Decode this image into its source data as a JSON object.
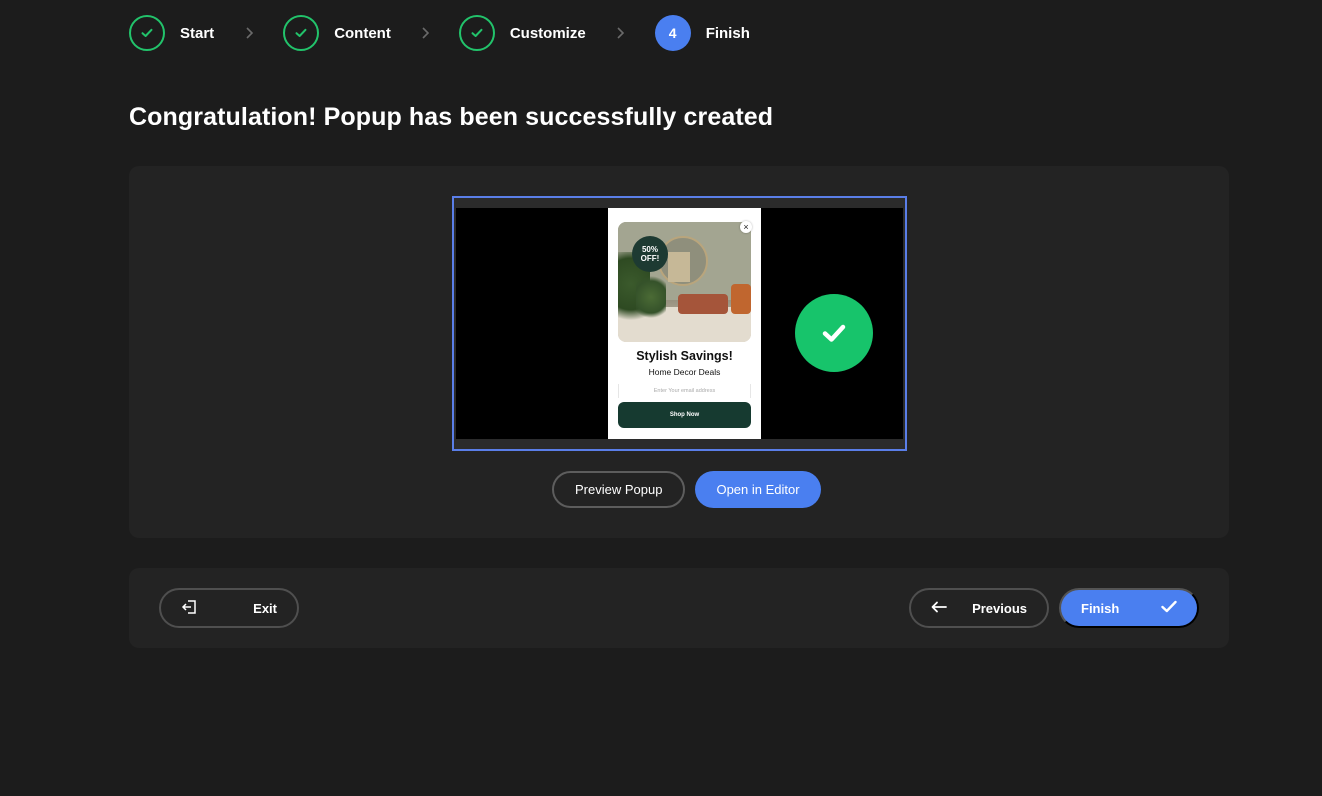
{
  "stepper": {
    "steps": [
      {
        "label": "Start",
        "state": "done"
      },
      {
        "label": "Content",
        "state": "done"
      },
      {
        "label": "Customize",
        "state": "done"
      },
      {
        "label": "Finish",
        "state": "active",
        "number": "4"
      }
    ]
  },
  "page": {
    "title": "Congratulation! Popup has been successfully created"
  },
  "preview": {
    "popup": {
      "badge": "50% OFF!",
      "headline": "Stylish Savings!",
      "subheadline": "Home Decor Deals",
      "email_placeholder": "Enter Your email address",
      "cta": "Shop Now"
    },
    "actions": {
      "preview_label": "Preview Popup",
      "editor_label": "Open in Editor"
    }
  },
  "footer": {
    "exit_label": "Exit",
    "previous_label": "Previous",
    "finish_label": "Finish"
  },
  "colors": {
    "background": "#1c1c1c",
    "card": "#232323",
    "accent_blue": "#4a7ff0",
    "success_green": "#17c46b"
  }
}
